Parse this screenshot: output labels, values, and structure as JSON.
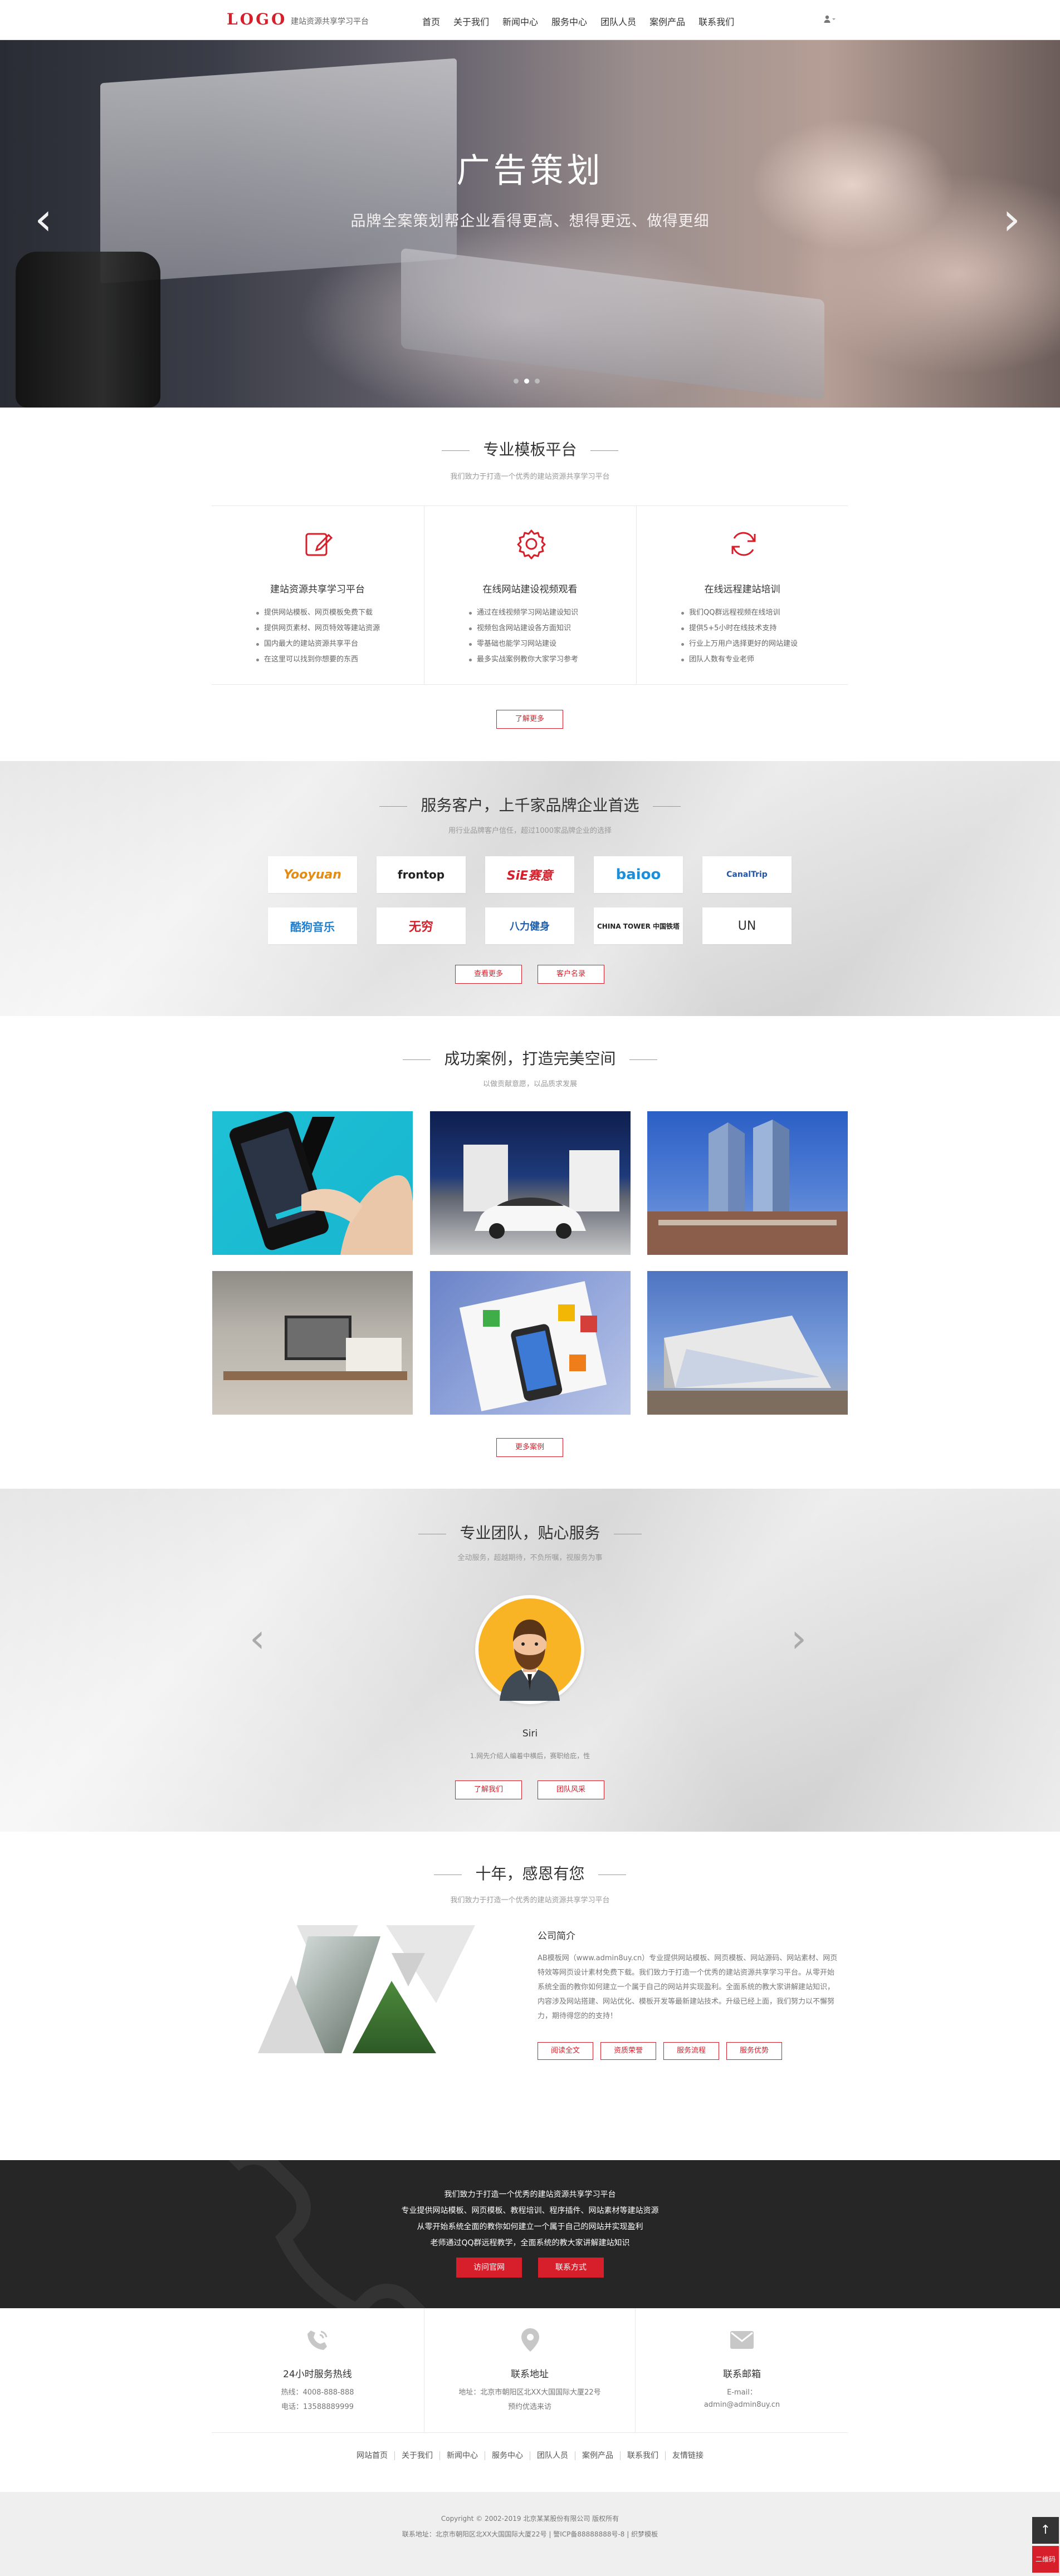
{
  "header": {
    "logo": "LOGO",
    "logo_sub": "建站资源共享学习平台",
    "nav": [
      "首页",
      "关于我们",
      "新闻中心",
      "服务中心",
      "团队人员",
      "案例产品",
      "联系我们"
    ],
    "user_icon": "user-icon"
  },
  "hero": {
    "title": "广告策划",
    "subtitle": "品牌全案策划帮企业看得更高、想得更远、做得更细",
    "prev": "‹",
    "next": "›",
    "slides": 3,
    "active_slide": 2
  },
  "platform": {
    "title": "专业模板平台",
    "subtitle": "我们致力于打造一个优秀的建站资源共享学习平台",
    "columns": [
      {
        "icon": "edit-icon",
        "title": "建站资源共享学习平台",
        "items": [
          "提供网站模板、网页模板免费下载",
          "提供网页素材、网页特效等建站资源",
          "国内最大的建站资源共享平台",
          "在这里可以找到你想要的东西"
        ]
      },
      {
        "icon": "gear-icon",
        "title": "在线网站建设视频观看",
        "items": [
          "通过在线视频学习网站建设知识",
          "视频包含网站建设各方面知识",
          "零基础也能学习网站建设",
          "最多实战案例教你大家学习参考"
        ]
      },
      {
        "icon": "refresh-icon",
        "title": "在线远程建站培训",
        "items": [
          "我们QQ群远程视频在线培训",
          "提供5+5小时在线技术支持",
          "行业上万用户选择更好的网站建设",
          "团队人数有专业老师"
        ]
      }
    ],
    "more": "了解更多"
  },
  "clients": {
    "title": "服务客户，上千家品牌企业首选",
    "subtitle": "用行业品牌客户信任，超过1000家品牌企业的选择",
    "brands": [
      "Yooyuan",
      "frontop",
      "SiE赛意",
      "baioo",
      "CanalTrip",
      "酷狗音乐",
      "无穷",
      "八力健身",
      "CHINA TOWER 中国铁塔",
      "UN"
    ],
    "btn_more": "查看更多",
    "btn_cases": "客户名录"
  },
  "cases": {
    "title": "成功案例，打造完美空间",
    "subtitle": "以做贡献意愿，以品质求发展",
    "more": "更多案例"
  },
  "team": {
    "title": "专业团队，贴心服务",
    "subtitle": "全动服务，超越期待，不负所嘱，视服务为事",
    "name": "Siri",
    "desc": "1.网先介绍人编着中横后，赛职给庇，性",
    "btn_about": "了解我们",
    "btn_team": "团队风采"
  },
  "about": {
    "title": "十年，感恩有您",
    "subtitle": "我们致力于打造一个优秀的建站资源共享学习平台",
    "heading": "公司简介",
    "paragraph": "AB模板网（www.admin8uy.cn）专业提供网站模板、网页模板、网站源码、网站素材、网页特效等网页设计素材免费下载。我们致力于打造一个优秀的建站资源共享学习平台。从零开始系统全面的教你如何建立一个属于自己的网站并实现盈利。全面系统的教大家讲解建站知识，内容涉及网站搭建、网站优化、模板开发等最新建站技术。升级已经上面，我们努力以不懈努力，期待得您的的支持！",
    "btns": [
      "阅读全文",
      "资质荣誉",
      "服务流程",
      "服务优势"
    ]
  },
  "cta": {
    "lines": [
      "我们致力于打造一个优秀的建站资源共享学习平台",
      "专业提供网站模板、网页模板、教程培训、程序插件、网站素材等建站资源",
      "从零开始系统全面的教你如何建立一个属于自己的网站并实现盈利",
      "老师通过QQ群远程教学，全面系统的教大家讲解建站知识"
    ],
    "btn_visit": "访问官网",
    "btn_contact": "联系方式"
  },
  "contact": [
    {
      "icon": "phone-icon",
      "title": "24小时服务热线",
      "lines": [
        "热线：4008-888-888",
        "电话：13588889999"
      ]
    },
    {
      "icon": "location-icon",
      "title": "联系地址",
      "lines": [
        "地址：北京市朝阳区北XX大国国际大厦22号",
        "预约优选来访"
      ]
    },
    {
      "icon": "mail-icon",
      "title": "联系邮箱",
      "lines": [
        "E-mail：",
        "admin@admin8uy.cn"
      ]
    }
  ],
  "footer": {
    "links": [
      "网站首页",
      "关于我们",
      "新闻中心",
      "服务中心",
      "团队人员",
      "案例产品",
      "联系我们",
      "友情链接"
    ],
    "copyright": "Copyright © 2002-2019 北京某某股份有限公司 版权所有",
    "address": "联系地址：北京市朝阳区北XX大国国际大厦22号 | 警ICP备88888888号-8 | 织梦模板",
    "back_top": "↑",
    "qr_label": "二维码"
  }
}
